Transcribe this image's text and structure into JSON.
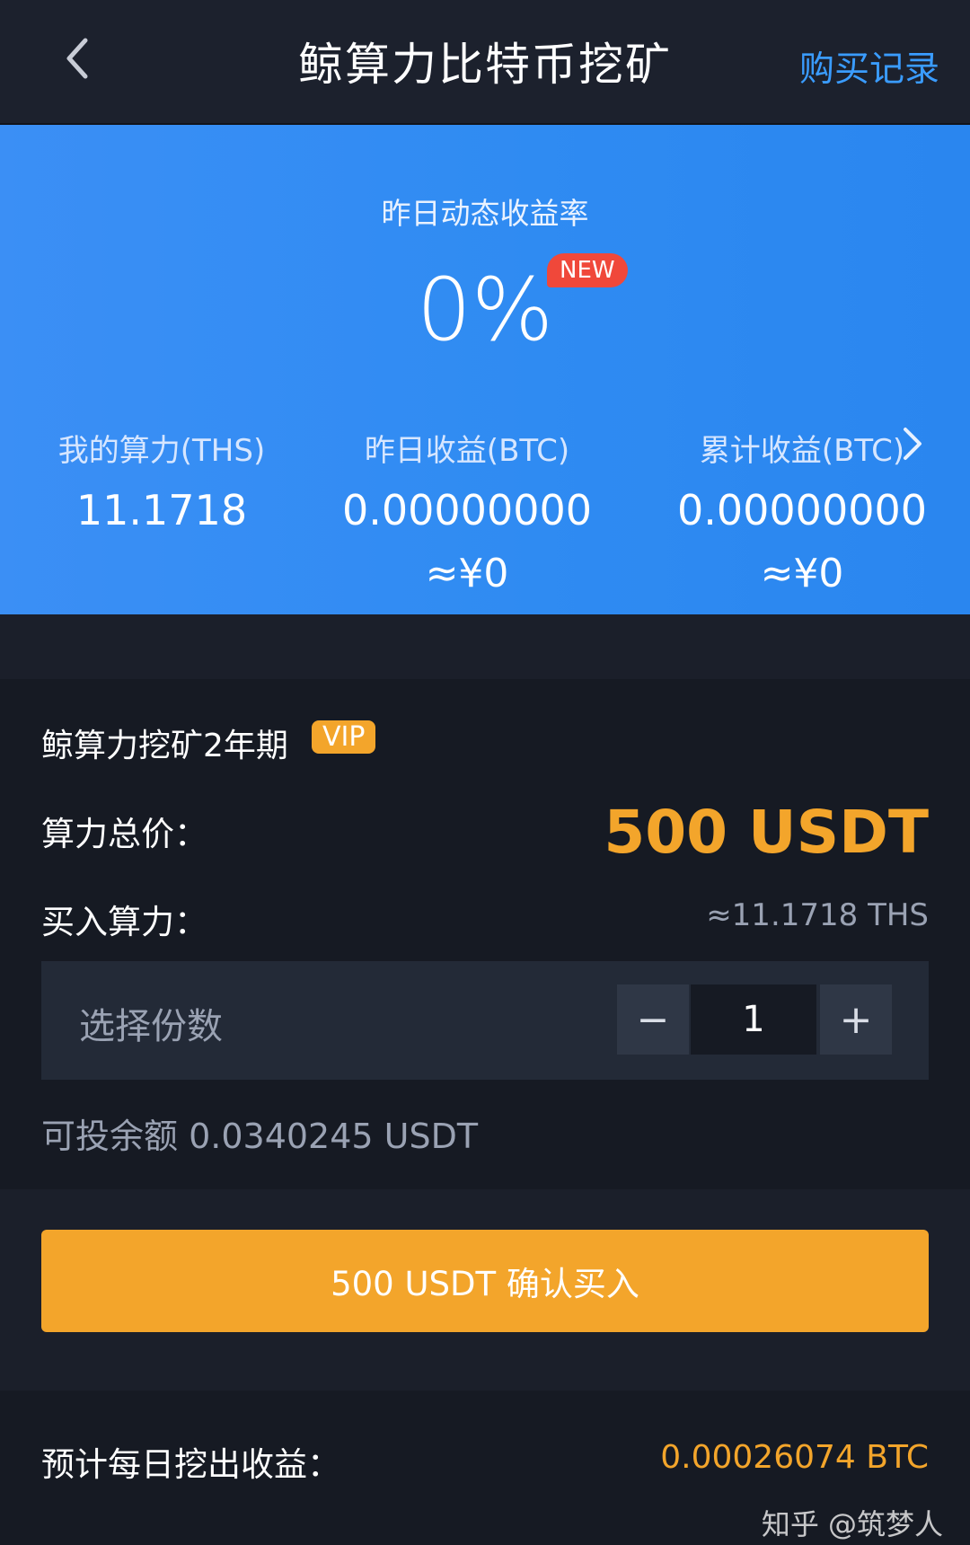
{
  "header": {
    "title": "鲸算力比特币挖矿",
    "right_link": "购买记录"
  },
  "hero": {
    "label": "昨日动态收益率",
    "rate": "0%",
    "badge": "NEW",
    "stats": [
      {
        "label": "我的算力(THS)",
        "value": "11.1718",
        "approx": ""
      },
      {
        "label": "昨日收益(BTC)",
        "value": "0.00000000",
        "approx": "≈¥0"
      },
      {
        "label": "累计收益(BTC)",
        "value": "0.00000000",
        "approx": "≈¥0"
      }
    ]
  },
  "product": {
    "title": "鲸算力挖矿2年期",
    "badge": "VIP",
    "price_label": "算力总价：",
    "price_value": "500 USDT",
    "hash_label": "买入算力：",
    "hash_value": "≈11.1718 THS",
    "qty_label": "选择份数",
    "qty_value": "1",
    "minus_symbol": "−",
    "plus_symbol": "+",
    "balance": "可投余额 0.0340245 USDT"
  },
  "confirm_button": "500 USDT 确认买入",
  "footer": {
    "daily_label": "预计每日挖出收益：",
    "daily_value": "0.00026074 BTC",
    "watermark": "知乎 @筑梦人"
  },
  "colors": {
    "accent": "#f3a52b",
    "link": "#3a9cff",
    "hero": "#3b8ff5",
    "badge_new": "#f0483a"
  }
}
